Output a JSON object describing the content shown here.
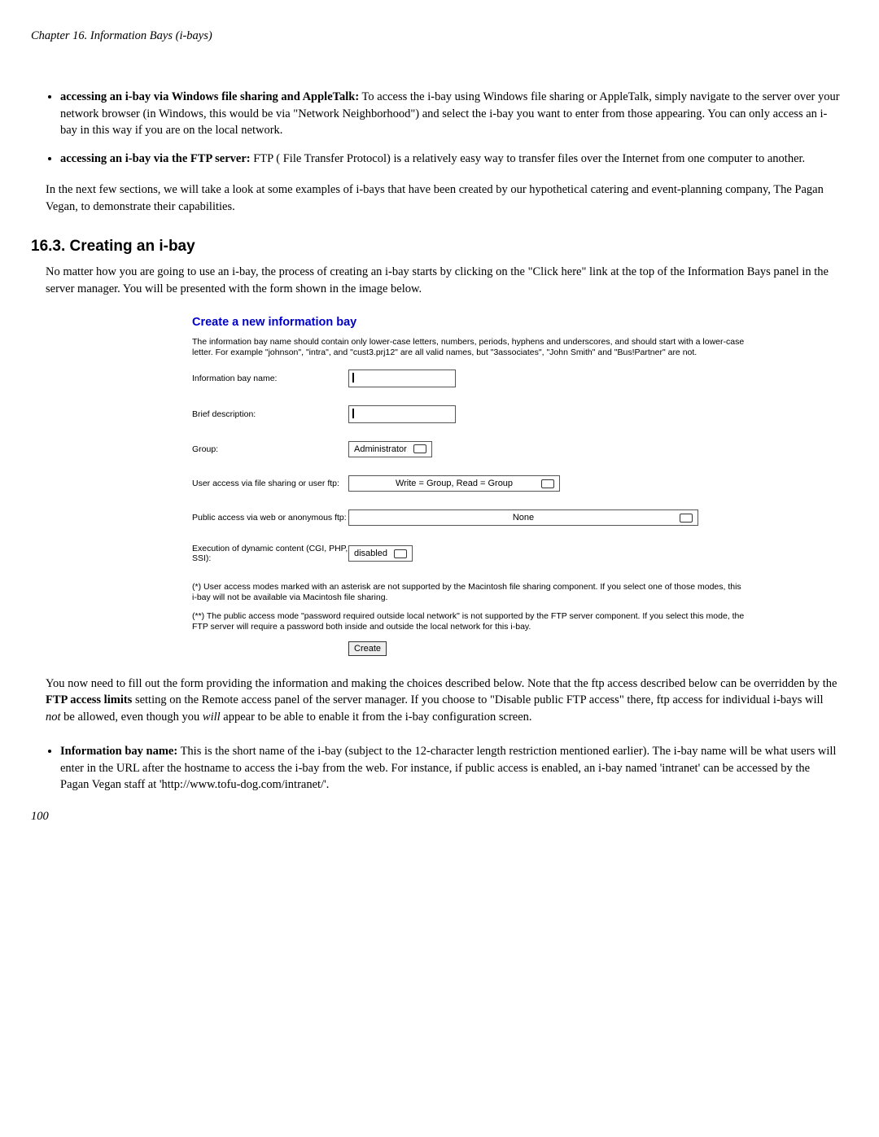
{
  "header": {
    "chapter": "Chapter 16. Information Bays (i-bays)"
  },
  "bullets": [
    {
      "lead": "accessing an i-bay via Windows file sharing and AppleTalk:",
      "rest": " To access the i-bay using Windows file sharing or AppleTalk, simply navigate to the server over your network browser (in Windows, this would be via \"Network Neighborhood\") and select the i-bay you want to enter from those appearing. You can only access an i-bay in this way if you are on the local network."
    },
    {
      "lead": "accessing an i-bay via the FTP server:",
      "rest": " FTP ( File Transfer Protocol) is a relatively easy way to transfer files over the Internet from one computer to another."
    }
  ],
  "after_list": "In the next few sections, we will take a look at some examples of i-bays that have been created by our hypothetical catering and event-planning company, The Pagan Vegan, to demonstrate their capabilities.",
  "section": {
    "heading": "16.3. Creating an i-bay",
    "intro": "No matter how you are going to use an i-bay, the process of creating an i-bay starts by clicking on the \"Click here\" link at the top of the Information Bays panel in the server manager. You will be presented with the form shown in the image below."
  },
  "form": {
    "title": "Create a new information bay",
    "intro": "The information bay name should contain only lower-case letters, numbers, periods, hyphens and underscores, and should start with a lower-case letter. For example \"johnson\", \"intra\", and \"cust3.prj12\" are all valid names, but \"3associates\", \"John Smith\" and \"Bus!Partner\" are not.",
    "rows": {
      "name_label": "Information bay name:",
      "desc_label": "Brief description:",
      "group_label": "Group:",
      "group_value": "Administrator",
      "useraccess_label": "User access via file sharing or user ftp:",
      "useraccess_value": "Write = Group, Read = Group",
      "publicaccess_label": "Public access via web or anonymous ftp:",
      "publicaccess_value": "None",
      "exec_label": "Execution of dynamic content (CGI, PHP, SSI):",
      "exec_value": "disabled"
    },
    "note1": "(*) User access modes marked with an asterisk are not supported by the Macintosh file sharing component. If you select one of those modes, this i-bay will not be available via Macintosh file sharing.",
    "note2": "(**) The public access mode \"password required outside local network\" is not supported by the FTP server component. If you select this mode, the FTP server will require a password both inside and outside the local network for this i-bay.",
    "button": "Create"
  },
  "after_form": {
    "part1": "You now need to fill out the form providing the information and making the choices described below. Note that the ftp access described below can be overridden by the ",
    "bold1": "FTP access limits",
    "part2": " setting on the Remote access panel of the server manager. If you choose to \"Disable public FTP access\" there, ftp access for individual i-bays will ",
    "em1": "not",
    "part3": " be allowed, even though you ",
    "em2": "will",
    "part4": " appear to be able to enable it from the i-bay configuration screen."
  },
  "desc_list": [
    {
      "lead": "Information bay name:",
      "rest": " This is the short name of the i-bay (subject to the 12-character length restriction mentioned earlier). The i-bay name will be what users will enter in the URL after the hostname to access the i-bay from the web. For instance, if public access is enabled, an i-bay named 'intranet' can be accessed by the Pagan Vegan staff at 'http://www.tofu-dog.com/intranet/'."
    }
  ],
  "page_number": "100"
}
